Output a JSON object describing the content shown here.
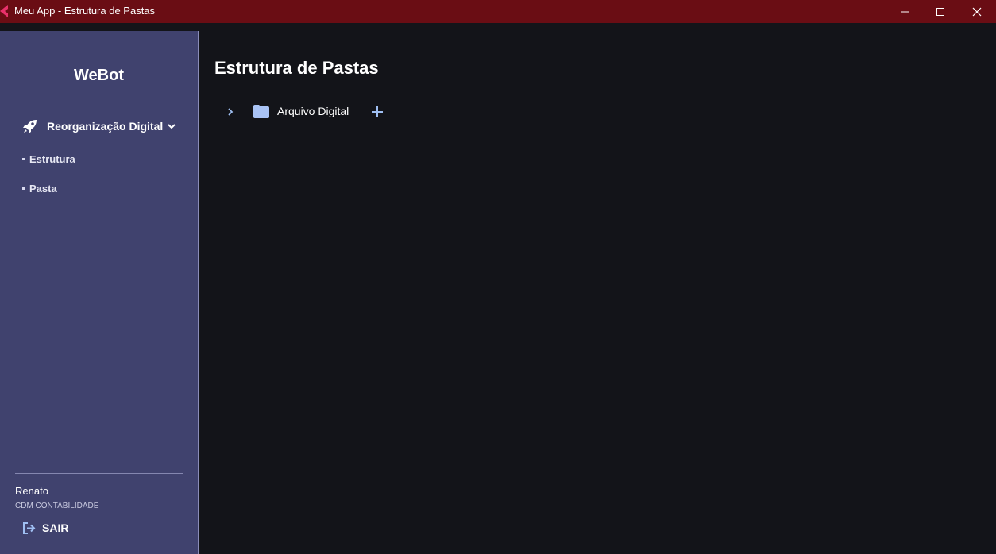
{
  "window": {
    "title": "Meu App - Estrutura de Pastas"
  },
  "colors": {
    "titlebar": "#6a0d14",
    "sidebar": "#40426e",
    "main_bg": "#131419",
    "accent": "#9fbff2"
  },
  "sidebar": {
    "brand": "WeBot",
    "group": {
      "label": "Reorganização Digital",
      "icon": "rocket-icon",
      "expanded": true
    },
    "items": [
      {
        "label": "Estrutura"
      },
      {
        "label": "Pasta"
      }
    ],
    "user": {
      "name": "Renato",
      "company": "CDM CONTABILIDADE"
    },
    "logout_label": "SAIR"
  },
  "main": {
    "title": "Estrutura de Pastas",
    "tree": [
      {
        "label": "Arquivo Digital",
        "expanded": false,
        "icon": "folder-icon"
      }
    ]
  }
}
